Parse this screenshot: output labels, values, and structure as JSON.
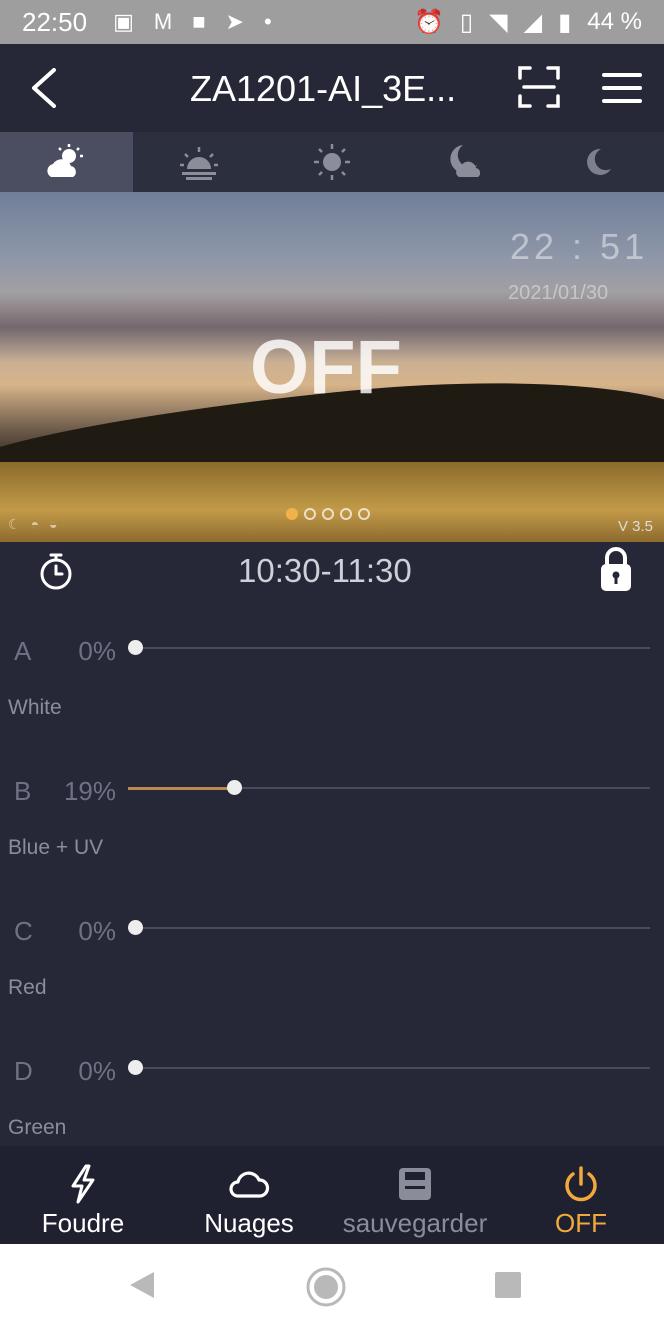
{
  "status_bar": {
    "time": "22:50",
    "battery": "44 %"
  },
  "header": {
    "title": "ZA1201-AI_3E...",
    "back_icon": "chevron-left-icon",
    "scan_icon": "scan-icon",
    "menu_icon": "hamburger-menu-icon"
  },
  "modes": [
    {
      "icon": "partly-cloudy-icon",
      "active": true
    },
    {
      "icon": "sunrise-icon",
      "active": false
    },
    {
      "icon": "sun-icon",
      "active": false
    },
    {
      "icon": "moon-cloud-icon",
      "active": false
    },
    {
      "icon": "crescent-moon-icon",
      "active": false
    }
  ],
  "hero": {
    "clock": "22 : 51",
    "date": "2021/01/30",
    "state": "OFF",
    "page_index": 1,
    "page_count": 5,
    "version": "V 3.5"
  },
  "schedule": {
    "range": "10:30-11:30"
  },
  "channels": [
    {
      "letter": "A",
      "percent": "0%",
      "value": 0,
      "name": "White"
    },
    {
      "letter": "B",
      "percent": "19%",
      "value": 19,
      "name": "Blue + UV"
    },
    {
      "letter": "C",
      "percent": "0%",
      "value": 0,
      "name": "Red"
    },
    {
      "letter": "D",
      "percent": "0%",
      "value": 0,
      "name": "Green"
    }
  ],
  "bottom_tabs": [
    {
      "label": "Foudre",
      "icon": "lightning-icon"
    },
    {
      "label": "Nuages",
      "icon": "cloud-icon"
    },
    {
      "label": "sauvegarder",
      "icon": "save-icon"
    },
    {
      "label": "OFF",
      "icon": "power-icon"
    }
  ],
  "colors": {
    "accent": "#f2a93b",
    "slider_fill": "#b88a52",
    "background": "#262837"
  }
}
